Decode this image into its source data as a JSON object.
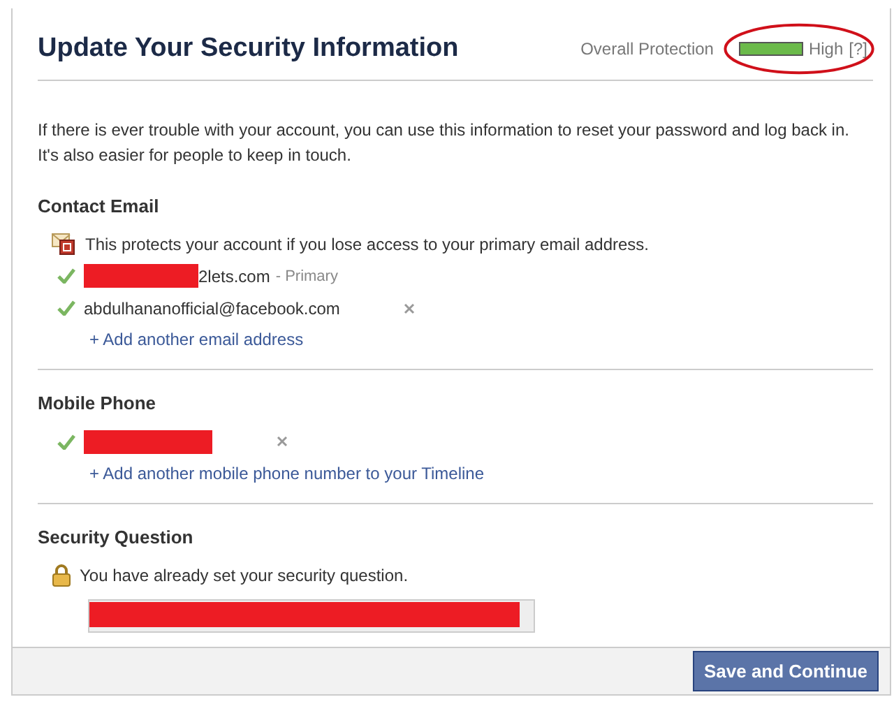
{
  "dialog": {
    "title": "Update Your Security Information",
    "protection": {
      "label": "Overall Protection",
      "level": 1,
      "rating": "High",
      "help": "[?]",
      "circled": true
    },
    "intro": "If there is ever trouble with your account, you can use this information to reset your password and log back in. It's also easier for people to keep in touch.",
    "sections": [
      {
        "heading": "Contact Email",
        "note": {
          "kind": "envelope",
          "text": "This protects your account if you lose access to your primary email address."
        },
        "items": [
          {
            "verified": true,
            "redacted": true,
            "text": "2lets.com",
            "tag": "- Primary",
            "removable": false
          },
          {
            "verified": true,
            "redacted": false,
            "text": "abdulhananofficial@facebook.com",
            "removable": true
          }
        ],
        "add_link": "+ Add another email address"
      },
      {
        "heading": "Mobile Phone",
        "items": [
          {
            "verified": true,
            "redacted": true,
            "removable": true
          }
        ],
        "add_link": "+ Add another mobile phone number to your Timeline"
      },
      {
        "heading": "Security Question",
        "note": {
          "kind": "lock",
          "text": "You have already set your security question."
        },
        "answer_field": {
          "redacted": true
        }
      }
    ]
  },
  "footer": {
    "button": "Save and Continue"
  }
}
